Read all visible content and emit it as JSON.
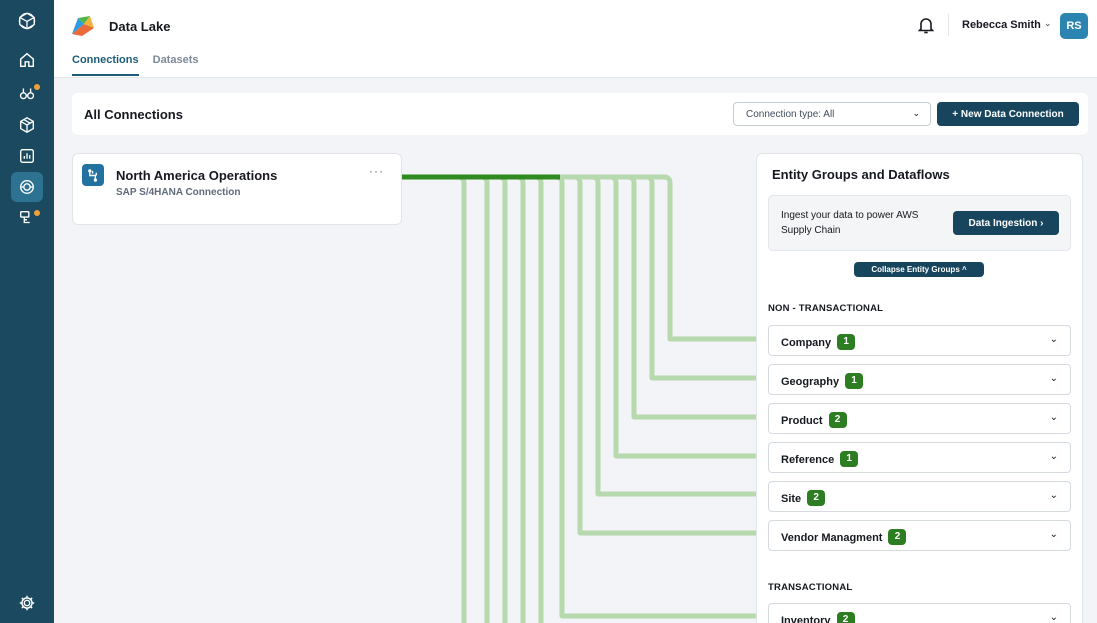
{
  "app": {
    "title": "Data Lake"
  },
  "tabs": [
    {
      "label": "Connections",
      "active": true
    },
    {
      "label": "Datasets",
      "active": false
    }
  ],
  "user": {
    "name": "Rebecca Smith",
    "initials": "RS"
  },
  "rail": {
    "icons": [
      "cube-logo-icon",
      "home-icon",
      "insights-icon",
      "package-icon",
      "chart-icon",
      "data-lake-icon",
      "workflow-icon",
      "settings-icon"
    ]
  },
  "connections_bar": {
    "title": "All Connections",
    "filter_value": "Connection type: All",
    "new_button": "+ New Data Connection"
  },
  "source": {
    "title": "North America Operations",
    "subtitle": "SAP S/4HANA Connection",
    "menu": "···"
  },
  "panel": {
    "title": "Entity Groups and Dataflows",
    "ingest_text": "Ingest your data to power AWS Supply Chain",
    "ingest_button": "Data Ingestion ›",
    "collapse_button": "Collapse Entity Groups ^",
    "non_transactional_label": "NON - TRANSACTIONAL",
    "transactional_label": "TRANSACTIONAL",
    "groups": [
      {
        "label": "Company",
        "count": "1"
      },
      {
        "label": "Geography",
        "count": "1"
      },
      {
        "label": "Product",
        "count": "2"
      },
      {
        "label": "Reference",
        "count": "1"
      },
      {
        "label": "Site",
        "count": "2"
      },
      {
        "label": "Vendor Managment",
        "count": "2"
      },
      {
        "label": "Inventory",
        "count": "2"
      }
    ]
  },
  "colors": {
    "rail": "#1b4a60",
    "primary_button": "#17455d",
    "flow_active": "#2f8a1f",
    "flow_muted": "#b6d9ad",
    "badge": "#2d7d22"
  }
}
